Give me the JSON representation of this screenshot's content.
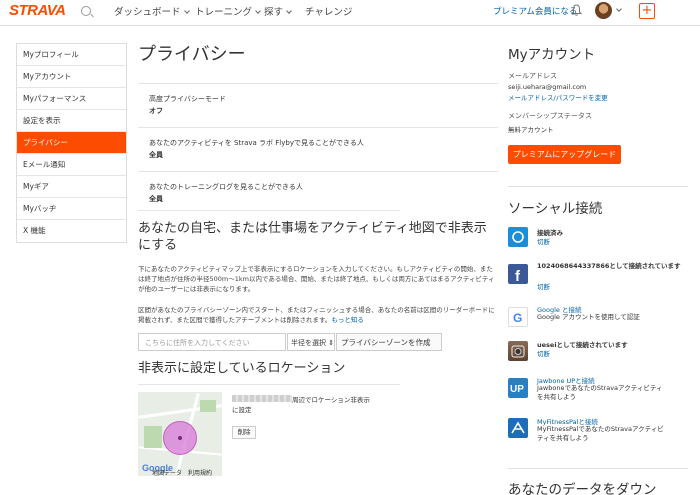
{
  "nav": {
    "logo": "STRAVA",
    "items": [
      {
        "label": "ダッシュボード"
      },
      {
        "label": "トレーニング"
      },
      {
        "label": "探す"
      },
      {
        "label": "チャレンジ"
      }
    ],
    "premium": "プレミアム会員になる",
    "add": "+"
  },
  "sidebar": {
    "items": [
      {
        "label": "Myプロフィール"
      },
      {
        "label": "Myアカウント"
      },
      {
        "label": "Myパフォーマンス"
      },
      {
        "label": "設定を表示"
      },
      {
        "label": "プライバシー",
        "active": true
      },
      {
        "label": "Eメール通知"
      },
      {
        "label": "Myギア"
      },
      {
        "label": "Myバッヂ"
      },
      {
        "label": "X 機能"
      }
    ]
  },
  "main": {
    "title": "プライバシー",
    "settings": [
      {
        "label": "高度プライバシーモード",
        "value": "オフ"
      },
      {
        "label": "あなたのアクティビティを Strava ラボ Flybyで見ることができる人",
        "value": "全員"
      },
      {
        "label": "あなたのトレーニングログを見ることができる人",
        "value": "全員"
      }
    ],
    "zone_section": {
      "title": "あなたの自宅、または仕事場をアクティビティ地図で非表示にする",
      "para1": "下にあなたのアクティビティマップ上で非表示にするロケーションを入力してください。もしアクティビティの開始、または終了地点が住所の半径500m〜1km以内である場合、開始、または終了地点、もしくは両方にあてはまるアクティビティが他のユーザーには非表示になります。",
      "para2": "区間があなたのプライバシーゾーン内でスタート、またはフィニッシュする場合、あなたの名前は区間のリーダーボードに掲載されず、また区間で獲得したアチーブメントは削除されます。",
      "more": "もっと知る",
      "input_placeholder": "こちらに住所を入力してください",
      "radius_label": "半径を選択",
      "create_button": "プライバシーゾーンを作成"
    },
    "hidden_section": {
      "title": "非表示に設定しているロケーション",
      "location_text": "周辺でロケーション非表示",
      "location_text2": "に設定",
      "delete_button": "削除",
      "map_labels": {
        "google": "Google",
        "terms": "地図データ　利用規約"
      }
    }
  },
  "account": {
    "title": "Myアカウント",
    "email_label": "メールアドレス",
    "email": "seiji.uehara@gmail.com",
    "email_link": "メールアドレス/パスワードを変更",
    "membership_label": "メンバーシップステータス",
    "membership": "無料アカウント",
    "upgrade_button": "プレミアムにアップグレード"
  },
  "social": {
    "title": "ソーシャル接続",
    "services": [
      {
        "name": "接続済み",
        "action": "切断",
        "icon": "garmin-icon",
        "color": "#1a8fd8"
      },
      {
        "name": "1024068644337866として接続されています",
        "action": "切断",
        "icon": "facebook-icon",
        "color": "#3b5998"
      },
      {
        "name": "Google と接続",
        "desc": "Google アカウントを使用して認証",
        "icon": "google-icon",
        "color": "#ffffff"
      },
      {
        "name": "ueseiとして接続されています",
        "action": "切断",
        "icon": "instagram-icon",
        "color": "#8a6a52"
      },
      {
        "name": "Jawbone UPと接続",
        "desc": "JawboneであなたのStravaアクティビティを共有しよう",
        "icon": "jawbone-icon",
        "color": "#2a7fc0"
      },
      {
        "name": "MyFitnessPalと接続",
        "desc": "MyFitnessPalであなたのStravaアクティビティを共有しよう",
        "icon": "myfitnesspal-icon",
        "color": "#1a6fb8"
      }
    ]
  },
  "data_section": {
    "title": "あなたのデータをダウン"
  }
}
